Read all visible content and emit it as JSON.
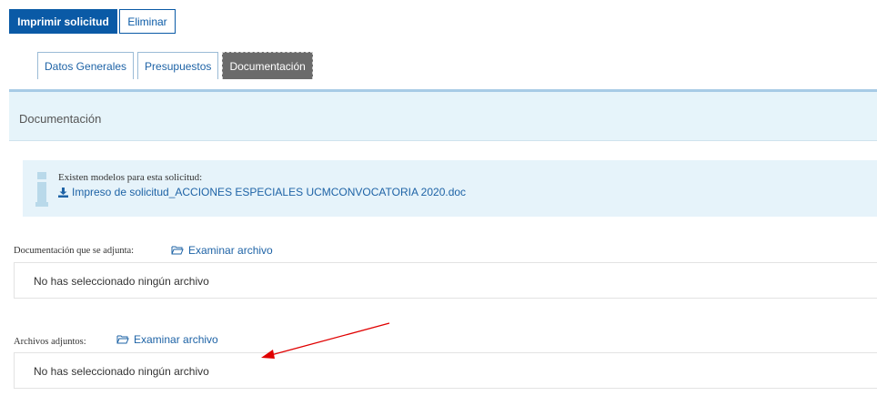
{
  "toolbar": {
    "print_label": "Imprimir solicitud",
    "delete_label": "Eliminar"
  },
  "tabs": [
    {
      "label": "Datos Generales",
      "active": false
    },
    {
      "label": "Presupuestos",
      "active": false
    },
    {
      "label": "Documentación",
      "active": true
    }
  ],
  "panel": {
    "title": "Documentación"
  },
  "info": {
    "text": "Existen modelos para esta solicitud:",
    "link": "Impreso de solicitud_ACCIONES ESPECIALES UCMCONVOCATORIA 2020.doc",
    "icon": "info-icon"
  },
  "attached_docs": {
    "label": "Documentación que se adjunta:",
    "browse": "Examinar archivo",
    "status": "No has seleccionado ningún archivo"
  },
  "attachments": {
    "label": "Archivos adjuntos:",
    "browse": "Examinar archivo",
    "status": "No has seleccionado ningún archivo"
  },
  "colors": {
    "primary": "#0a5aa6",
    "link": "#1e63a6",
    "panel_bg": "#e6f4fa",
    "annotation": "#e00000"
  }
}
